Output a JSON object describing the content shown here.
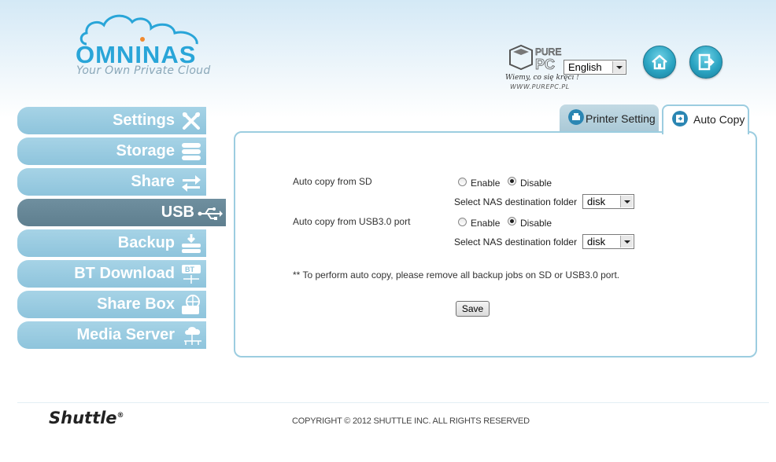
{
  "header": {
    "logo_text": "OMNINAS",
    "logo_tagline": "Your Own Private Cloud",
    "watermark_text": "Wiemy, co się kręci !",
    "watermark_url": "WWW.PUREPC.PL",
    "language": {
      "selected": "English"
    },
    "home_icon": "home-icon",
    "logout_icon": "logout-icon"
  },
  "sidebar": {
    "items": [
      {
        "label": "Settings",
        "icon": "tools-icon",
        "active": false
      },
      {
        "label": "Storage",
        "icon": "storage-icon",
        "active": false
      },
      {
        "label": "Share",
        "icon": "share-arrows-icon",
        "active": false
      },
      {
        "label": "USB",
        "icon": "usb-icon",
        "active": true
      },
      {
        "label": "Backup",
        "icon": "backup-icon",
        "active": false
      },
      {
        "label": "BT Download",
        "icon": "bt-download-icon",
        "active": false
      },
      {
        "label": "Share Box",
        "icon": "share-box-icon",
        "active": false
      },
      {
        "label": "Media Server",
        "icon": "media-server-icon",
        "active": false
      }
    ]
  },
  "tabs": [
    {
      "label": "Printer Setting",
      "icon": "printer-icon",
      "active": false
    },
    {
      "label": "Auto Copy",
      "icon": "auto-copy-icon",
      "active": true
    }
  ],
  "auto_copy": {
    "sd": {
      "label": "Auto copy from SD",
      "enable_label": "Enable",
      "disable_label": "Disable",
      "selected": "Disable",
      "folder_label": "Select NAS destination folder",
      "folder_value": "disk"
    },
    "usb": {
      "label": "Auto copy from USB3.0 port",
      "enable_label": "Enable",
      "disable_label": "Disable",
      "selected": "Disable",
      "folder_label": "Select NAS destination folder",
      "folder_value": "disk"
    },
    "note": "** To perform auto copy, please remove all backup jobs on SD or USB3.0 port.",
    "save_label": "Save"
  },
  "footer": {
    "brand": "Shuttle",
    "brand_mark": "®",
    "copyright": "COPYRIGHT © 2012 SHUTTLE INC. ALL RIGHTS RESERVED"
  },
  "colors": {
    "nav_bg": "#8ec4dc",
    "nav_active_bg": "#5f7f8f",
    "panel_border": "#9ccde0",
    "logo_blue": "#29a5d8"
  }
}
